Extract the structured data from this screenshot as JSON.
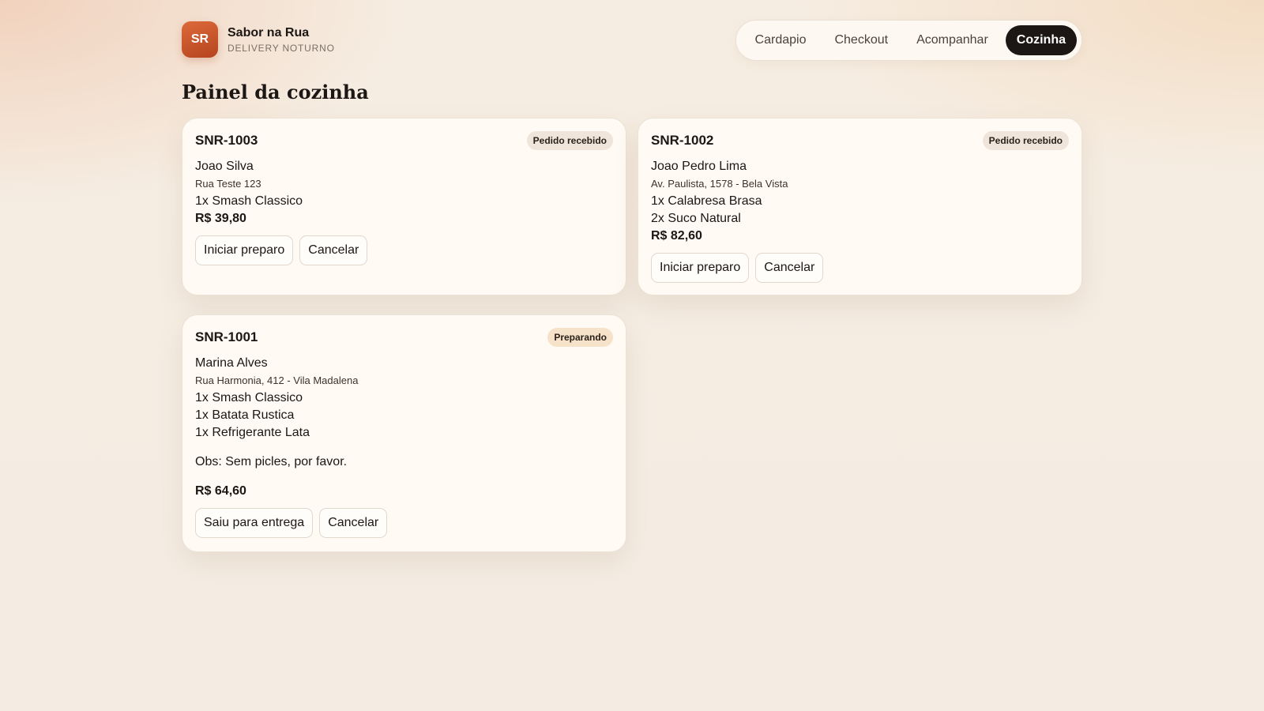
{
  "brand": {
    "logo": "SR",
    "name": "Sabor na Rua",
    "subtitle": "DELIVERY NOTURNO"
  },
  "nav": {
    "items": [
      "Cardapio",
      "Checkout",
      "Acompanhar",
      "Cozinha"
    ],
    "active": "Cozinha"
  },
  "page": {
    "title": "Painel da cozinha"
  },
  "orders": [
    {
      "id": "SNR-1003",
      "status": "Pedido recebido",
      "customer": "Joao Silva",
      "address": "Rua Teste 123",
      "items": [
        "1x Smash Classico"
      ],
      "total": "R$ 39,80",
      "actions": [
        "Iniciar preparo",
        "Cancelar"
      ]
    },
    {
      "id": "SNR-1002",
      "status": "Pedido recebido",
      "customer": "Joao Pedro Lima",
      "address": "Av. Paulista, 1578 - Bela Vista",
      "items": [
        "1x Calabresa Brasa",
        "2x Suco Natural"
      ],
      "total": "R$ 82,60",
      "actions": [
        "Iniciar preparo",
        "Cancelar"
      ]
    },
    {
      "id": "SNR-1001",
      "status": "Preparando",
      "customer": "Marina Alves",
      "address": "Rua Harmonia, 412 - Vila Madalena",
      "items": [
        "1x Smash Classico",
        "1x Batata Rustica",
        "1x Refrigerante Lata"
      ],
      "obs": "Obs: Sem picles, por favor.",
      "total": "R$ 64,60",
      "actions": [
        "Saiu para entrega",
        "Cancelar"
      ]
    }
  ]
}
